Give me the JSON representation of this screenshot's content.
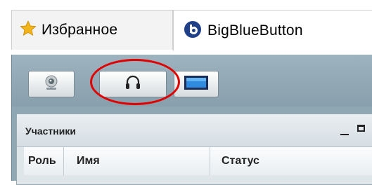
{
  "browser": {
    "tabs": [
      {
        "label": "Избранное",
        "icon": "star-icon"
      },
      {
        "label": "BigBlueButton",
        "icon": "bigbluebutton-logo-icon"
      }
    ]
  },
  "toolbar": {
    "buttons": [
      {
        "icon": "webcam-icon"
      },
      {
        "icon": "headset-icon",
        "highlighted": true
      },
      {
        "icon": "desktop-share-icon"
      }
    ],
    "highlight_color": "#e00000"
  },
  "participants_panel": {
    "title": "Участники",
    "columns": [
      "Роль",
      "Имя",
      "Статус"
    ]
  }
}
